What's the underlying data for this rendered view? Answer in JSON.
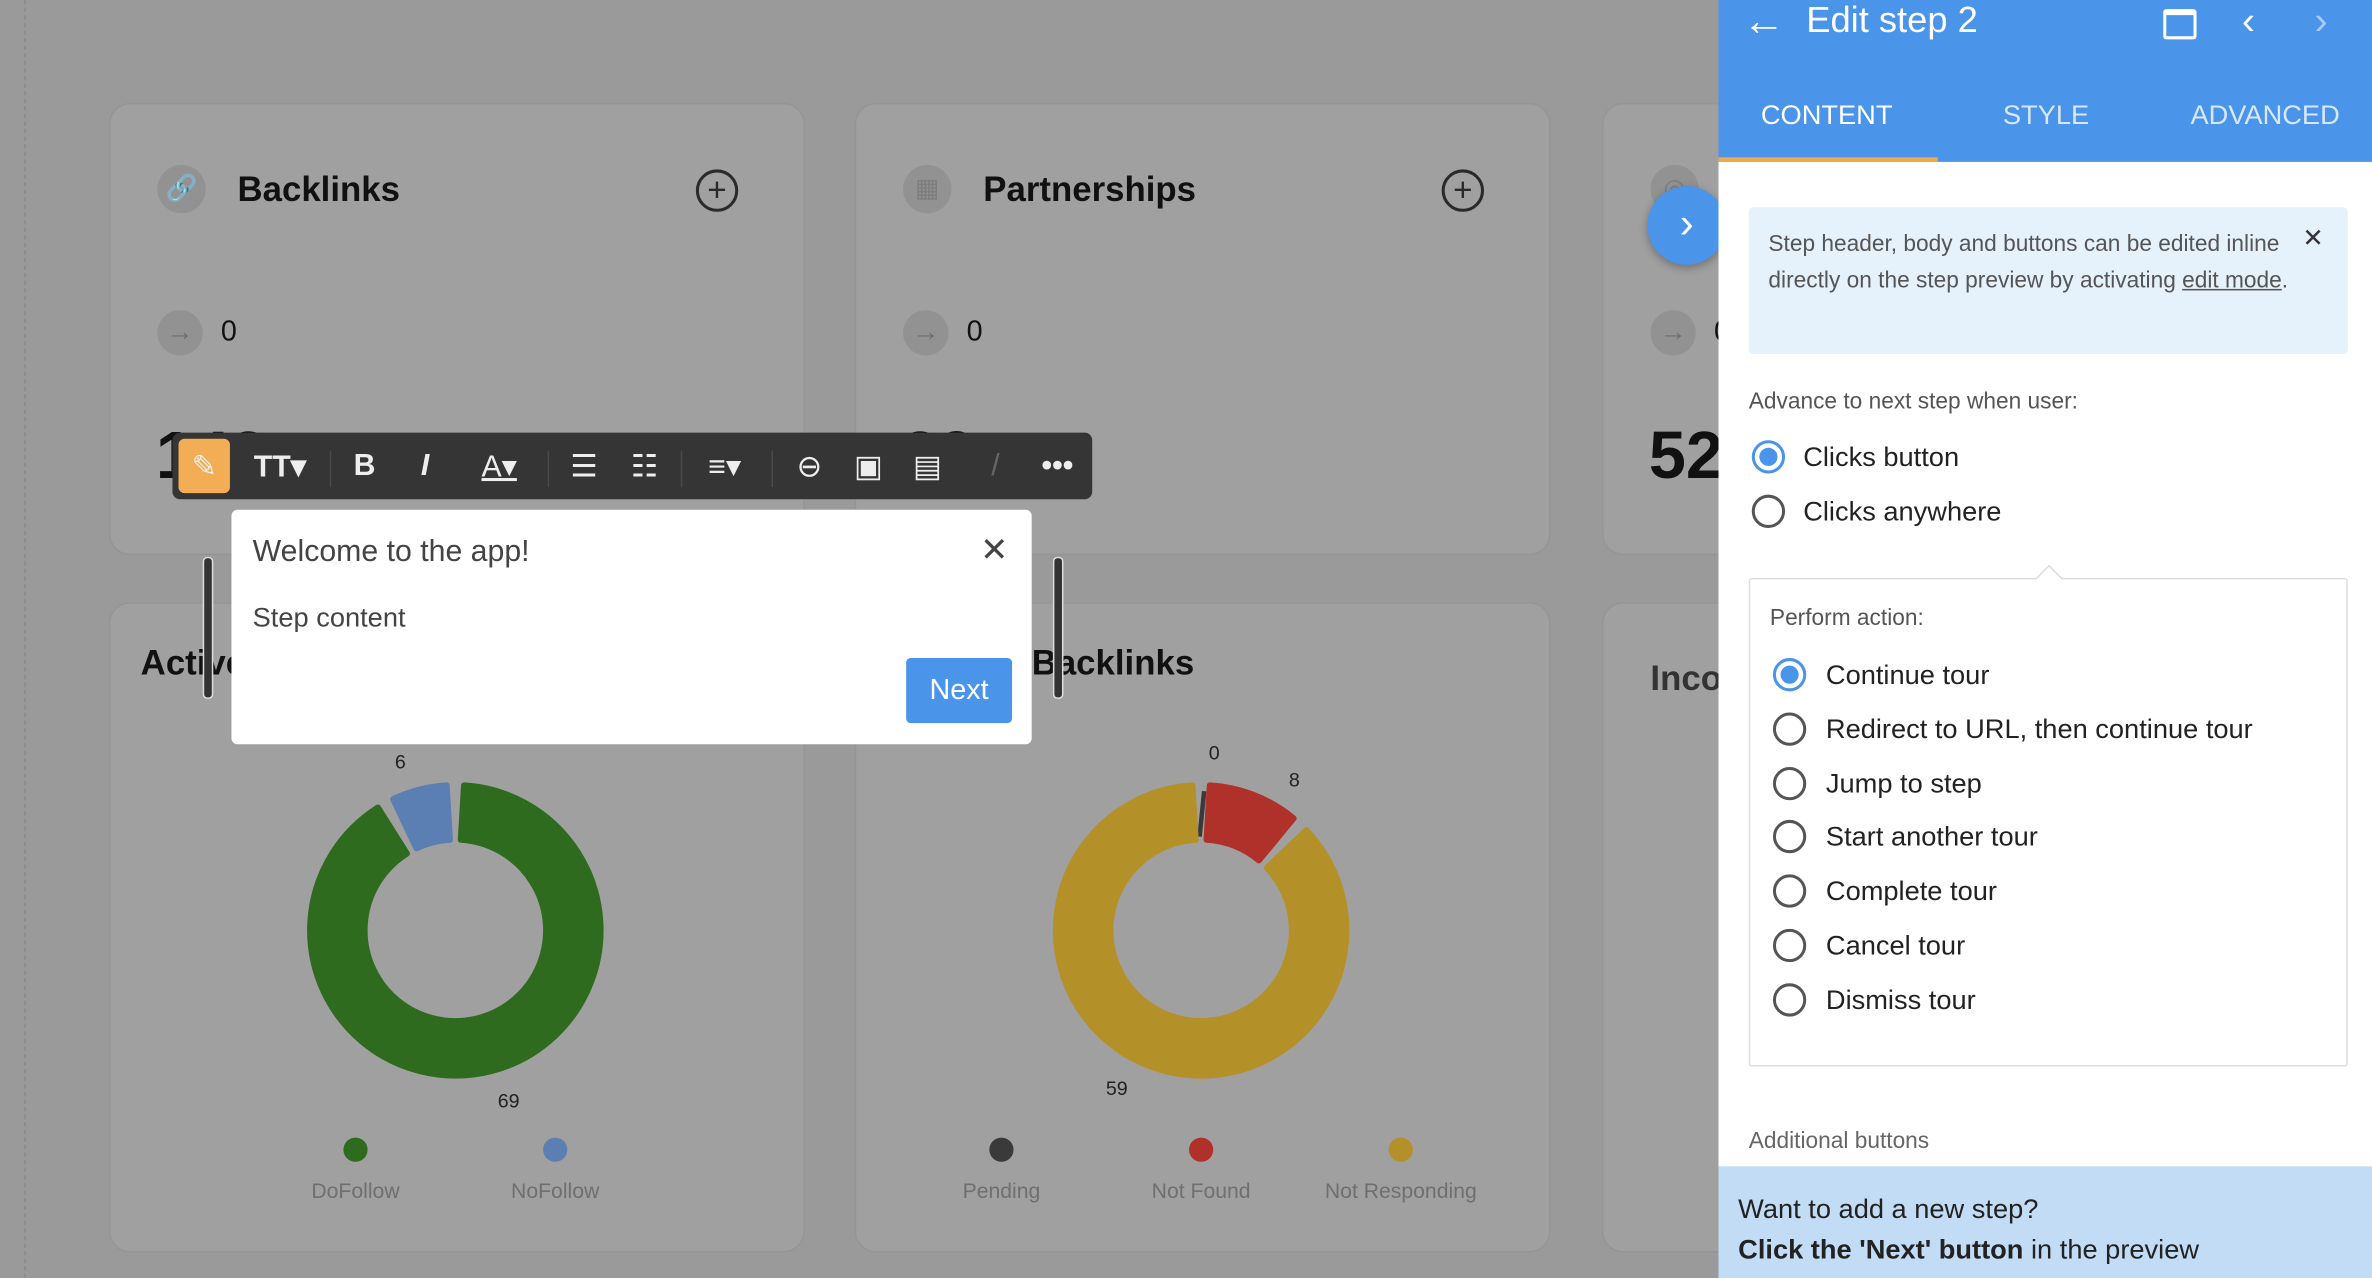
{
  "dashboard": {
    "cards": [
      {
        "title": "Backlinks",
        "icon": "link-icon",
        "count": "0",
        "big": "142"
      },
      {
        "title": "Partnerships",
        "icon": "grid-icon",
        "count": "0",
        "big": "29"
      },
      {
        "title": "",
        "icon": "target-icon",
        "count": "0",
        "big": "52"
      }
    ],
    "sections": [
      {
        "title": "Active"
      },
      {
        "title": "Backlinks"
      },
      {
        "title": "Inco"
      }
    ]
  },
  "chart_data": [
    {
      "type": "pie",
      "variant": "donut",
      "categories": [
        "DoFollow",
        "NoFollow"
      ],
      "values": [
        69,
        6
      ],
      "colors": [
        "#2f6b1e",
        "#5b7fb3"
      ],
      "legend": "bottom"
    },
    {
      "type": "pie",
      "variant": "donut",
      "categories": [
        "Pending",
        "Not Found",
        "Not Responding"
      ],
      "values": [
        0,
        8,
        59
      ],
      "colors": [
        "#3a3a3a",
        "#b0302a",
        "#b39028"
      ],
      "legend": "bottom"
    }
  ],
  "toolbar": {
    "items": [
      "pencil-icon",
      "text-size-icon",
      "bold-icon",
      "italic-icon",
      "font-color-icon",
      "bullet-list-icon",
      "numbered-list-icon",
      "align-icon",
      "link-icon",
      "image-icon",
      "video-icon",
      "brush-icon",
      "more-icon"
    ]
  },
  "popup": {
    "title": "Welcome to the app!",
    "body": "Step content",
    "next": "Next"
  },
  "panel": {
    "title": "Edit step 2",
    "tabs": [
      "CONTENT",
      "STYLE",
      "ADVANCED"
    ],
    "active_tab": "CONTENT",
    "info": {
      "text": "Step header, body and buttons can be edited inline directly on the step preview by activating ",
      "link": "edit mode",
      "suffix": "."
    },
    "advance_label": "Advance to next step when user:",
    "advance_options": [
      "Clicks button",
      "Clicks anywhere"
    ],
    "advance_selected": "Clicks button",
    "action_label": "Perform action:",
    "action_options": [
      "Continue tour",
      "Redirect to URL, then continue tour",
      "Jump to step",
      "Start another tour",
      "Complete tour",
      "Cancel tour",
      "Dismiss tour"
    ],
    "action_selected": "Continue tour",
    "additional_label": "Additional buttons",
    "footer": {
      "line1": "Want to add a new step?",
      "bold": "Click the 'Next' button",
      "rest": " in the preview"
    }
  },
  "colors": {
    "accent": "#4a94ea",
    "tab_indicator": "#f0a94a",
    "info_bg": "#e5f1fb",
    "footer_bg": "#c2dcf5"
  }
}
